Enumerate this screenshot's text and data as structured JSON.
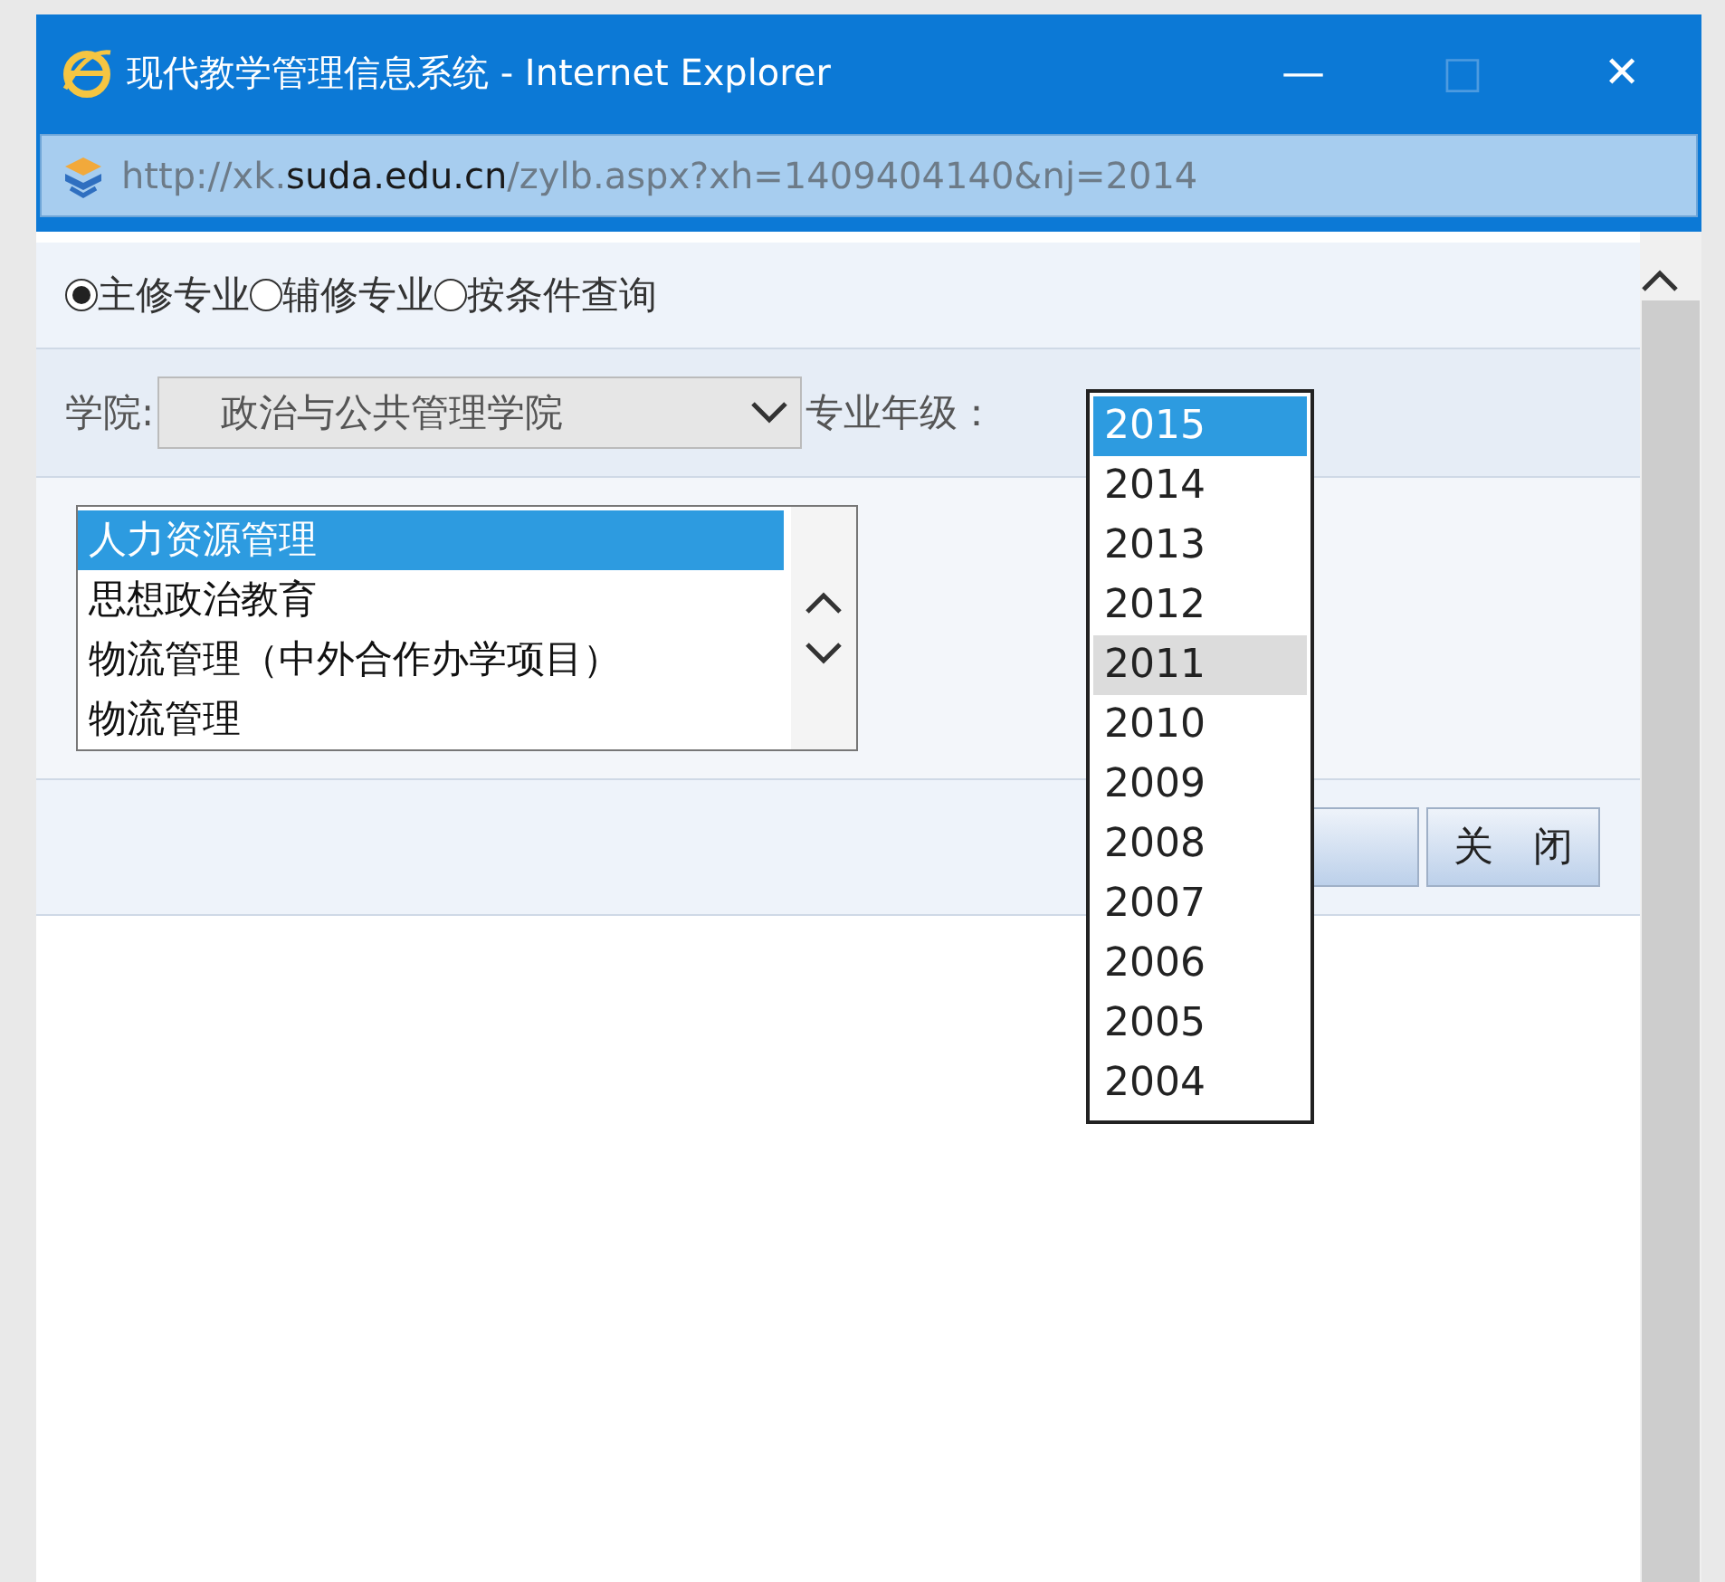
{
  "window": {
    "title": "现代教学管理信息系统 - Internet Explorer",
    "controls": [
      "—",
      "□",
      "✕"
    ]
  },
  "address_bar": {
    "url_prefix": "http://xk.",
    "url_domain": "suda.edu.cn",
    "url_rest": "/zylb.aspx?xh=1409404140&nj=2014"
  },
  "radios": [
    {
      "label": "主修专业",
      "selected": true
    },
    {
      "label": "辅修专业",
      "selected": false
    },
    {
      "label": "按条件查询",
      "selected": false
    }
  ],
  "college": {
    "label": "学院:",
    "value": "政治与公共管理学院",
    "disabled": true
  },
  "grade": {
    "label": "专业年级："
  },
  "major_list": [
    {
      "label": "人力资源管理",
      "selected": true
    },
    {
      "label": "思想政治教育",
      "selected": false
    },
    {
      "label": "物流管理（中外合作办学项目）",
      "selected": false
    },
    {
      "label": "物流管理",
      "selected": false
    }
  ],
  "buttons": [
    {
      "kind": "blank"
    },
    {
      "kind": "text",
      "label": "关　闭"
    }
  ],
  "year_dropdown": [
    {
      "label": "2015",
      "selected": true,
      "hovered": false
    },
    {
      "label": "2014",
      "selected": false,
      "hovered": false
    },
    {
      "label": "2013",
      "selected": false,
      "hovered": false
    },
    {
      "label": "2012",
      "selected": false,
      "hovered": false
    },
    {
      "label": "2011",
      "selected": false,
      "hovered": true
    },
    {
      "label": "2010",
      "selected": false,
      "hovered": false
    },
    {
      "label": "2009",
      "selected": false,
      "hovered": false
    },
    {
      "label": "2008",
      "selected": false,
      "hovered": false
    },
    {
      "label": "2007",
      "selected": false,
      "hovered": false
    },
    {
      "label": "2006",
      "selected": false,
      "hovered": false
    },
    {
      "label": "2005",
      "selected": false,
      "hovered": false
    },
    {
      "label": "2004",
      "selected": false,
      "hovered": false
    }
  ]
}
